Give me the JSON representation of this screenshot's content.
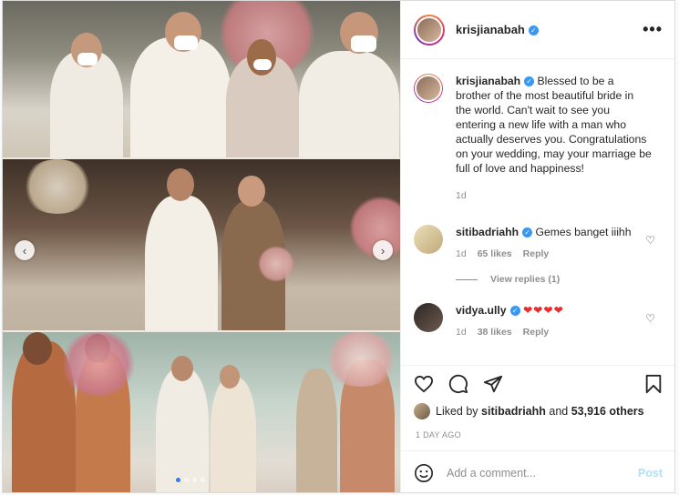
{
  "post": {
    "author": "krisjianabah",
    "caption_text": "Blessed to be a brother of the most beautiful bride in the world. Can't wait to see you entering a new life with a man who actually deserves you. Congratulations on your wedding, may your marriage be full of love and happiness!",
    "caption_age": "1d",
    "more_label": "•••"
  },
  "comments": [
    {
      "user": "sitibadriahh",
      "text": "Gemes banget iiihh",
      "age": "1d",
      "likes": "65 likes",
      "reply": "Reply",
      "view_replies": "View replies (1)"
    },
    {
      "user": "vidya.ully",
      "text": "❤❤❤❤",
      "age": "1d",
      "likes": "38 likes",
      "reply": "Reply"
    }
  ],
  "likes": {
    "prefix": "Liked by",
    "user": "sitibadriahh",
    "mid": "and",
    "count": "53,916 others"
  },
  "time_ago": "1 DAY AGO",
  "add_comment": {
    "placeholder": "Add a comment...",
    "post_label": "Post"
  },
  "carousel": {
    "total": 4,
    "active_index": 0
  },
  "colors": {
    "verified": "#3897f0",
    "link_blue": "#b2dffc",
    "heart_red": "#ed2a2a"
  },
  "icons": [
    "verified-badge-icon",
    "more-options-icon",
    "heart-icon",
    "comment-icon",
    "share-icon",
    "bookmark-icon",
    "emoji-icon",
    "chevron-left-icon",
    "chevron-right-icon"
  ]
}
